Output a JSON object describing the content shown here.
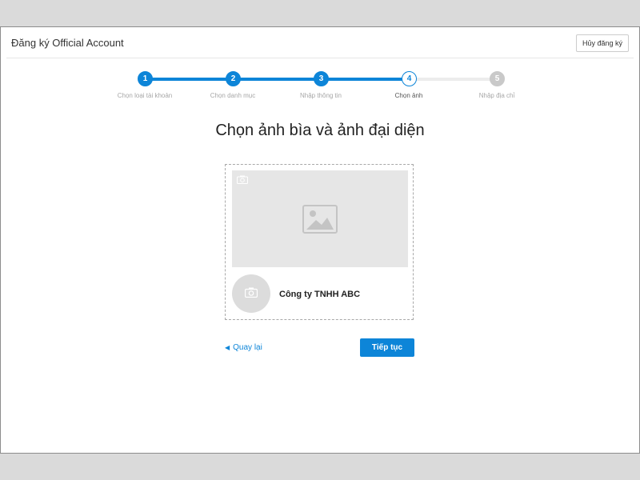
{
  "header": {
    "title": "Đăng ký Official Account",
    "cancel_label": "Hủy đăng ký"
  },
  "steps": [
    {
      "number": "1",
      "label": "Chọn loại tài khoản",
      "state": "done"
    },
    {
      "number": "2",
      "label": "Chọn danh mục",
      "state": "done"
    },
    {
      "number": "3",
      "label": "Nhập thông tin",
      "state": "done"
    },
    {
      "number": "4",
      "label": "Chọn ảnh",
      "state": "active"
    },
    {
      "number": "5",
      "label": "Nhập địa chỉ",
      "state": "todo"
    }
  ],
  "main": {
    "heading": "Chọn ảnh bìa và ảnh đại diện",
    "company_name": "Công ty TNHH ABC"
  },
  "actions": {
    "back_label": "Quay lại",
    "continue_label": "Tiếp tục"
  },
  "icons": {
    "cover_camera": "camera-icon",
    "cover_placeholder": "image-placeholder-icon",
    "avatar_camera": "camera-icon",
    "back_arrow": "caret-left-icon"
  },
  "colors": {
    "accent": "#0d85d8",
    "inactive_step": "#c9c9c9",
    "placeholder": "#e6e6e6"
  }
}
